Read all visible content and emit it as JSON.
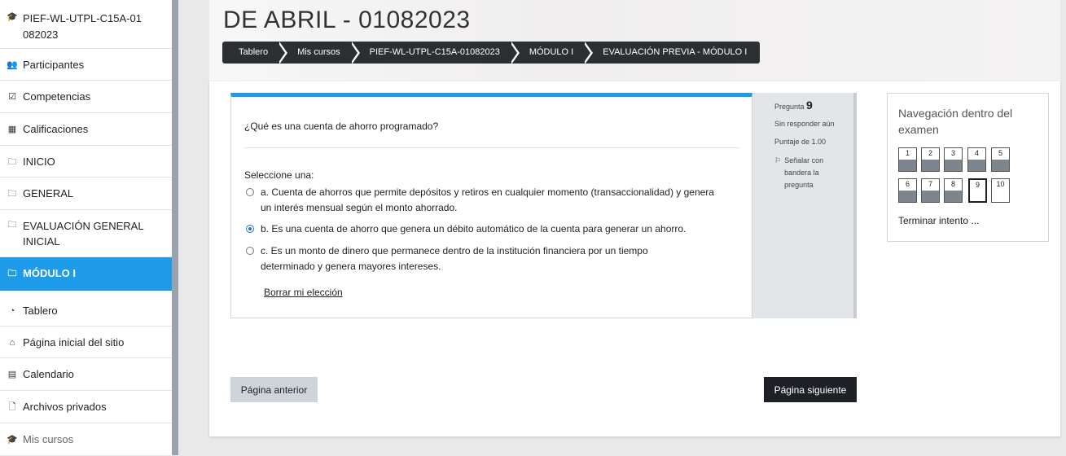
{
  "sidebar": {
    "items": [
      {
        "label": "PIEF-WL-UTPL-C15A-01082023",
        "icon": "graduation-cap-icon",
        "glyph": "🎓"
      },
      {
        "label": "Participantes",
        "icon": "users-icon",
        "glyph": "👥"
      },
      {
        "label": "Competencias",
        "icon": "checkbox-icon",
        "glyph": "☑"
      },
      {
        "label": "Calificaciones",
        "icon": "table-icon",
        "glyph": "▦"
      },
      {
        "label": "INICIO",
        "icon": "folder-icon",
        "glyph": "🗀"
      },
      {
        "label": "GENERAL",
        "icon": "folder-icon",
        "glyph": "🗀"
      },
      {
        "label": "EVALUACIÓN GENERAL INICIAL",
        "icon": "folder-icon",
        "glyph": "🗀"
      },
      {
        "label": "MÓDULO I",
        "icon": "folder-icon",
        "glyph": "🗀",
        "active": true
      },
      {
        "label": "Tablero",
        "icon": "dashboard-icon",
        "glyph": "◔"
      },
      {
        "label": "Página inicial del sitio",
        "icon": "home-icon",
        "glyph": "⌂"
      },
      {
        "label": "Calendario",
        "icon": "calendar-icon",
        "glyph": "▤"
      },
      {
        "label": "Archivos privados",
        "icon": "file-icon",
        "glyph": "🗋"
      },
      {
        "label": "Mis cursos",
        "icon": "graduation-cap-icon",
        "glyph": "🎓"
      }
    ]
  },
  "header": {
    "title": "DE ABRIL - 01082023",
    "breadcrumb": [
      "Tablero",
      "Mis cursos",
      "PIEF-WL-UTPL-C15A-01082023",
      "MÓDULO I",
      "EVALUACIÓN PREVIA - MÓDULO I"
    ]
  },
  "question": {
    "text": "¿Qué es una cuenta de ahorro programado?",
    "prompt": "Seleccione una:",
    "options": [
      {
        "text": "a. Cuenta de ahorros que permite depósitos y retiros en cualquier momento (transaccionalidad) y genera un interés mensual según el monto ahorrado.",
        "selected": false
      },
      {
        "text": "b. Es una cuenta de ahorro que genera un débito automático de la cuenta para generar un ahorro.",
        "selected": true
      },
      {
        "text": "c. Es un monto de dinero que permanece dentro de la institución financiera por un tiempo determinado y genera mayores intereses.",
        "selected": false
      }
    ],
    "clear_label": "Borrar mi elección"
  },
  "qinfo": {
    "label": "Pregunta",
    "number": "9",
    "status": "Sin responder aún",
    "score": "Puntaje de 1.00",
    "flag_label": "Señalar con bandera la pregunta"
  },
  "quiz_nav": {
    "title": "Navegación dentro del examen",
    "questions": [
      {
        "label": "1",
        "answered": true
      },
      {
        "label": "2",
        "answered": true
      },
      {
        "label": "3",
        "answered": true
      },
      {
        "label": "4",
        "answered": true
      },
      {
        "label": "5",
        "answered": true
      },
      {
        "label": "6",
        "answered": true
      },
      {
        "label": "7",
        "answered": true
      },
      {
        "label": "8",
        "answered": true
      },
      {
        "label": "9",
        "answered": false,
        "current": true
      },
      {
        "label": "10",
        "answered": false
      }
    ],
    "finish_label": "Terminar intento ..."
  },
  "buttons": {
    "prev": "Página anterior",
    "next": "Página siguiente"
  },
  "colors": {
    "accent": "#1e9be9",
    "dark": "#1d2125"
  }
}
